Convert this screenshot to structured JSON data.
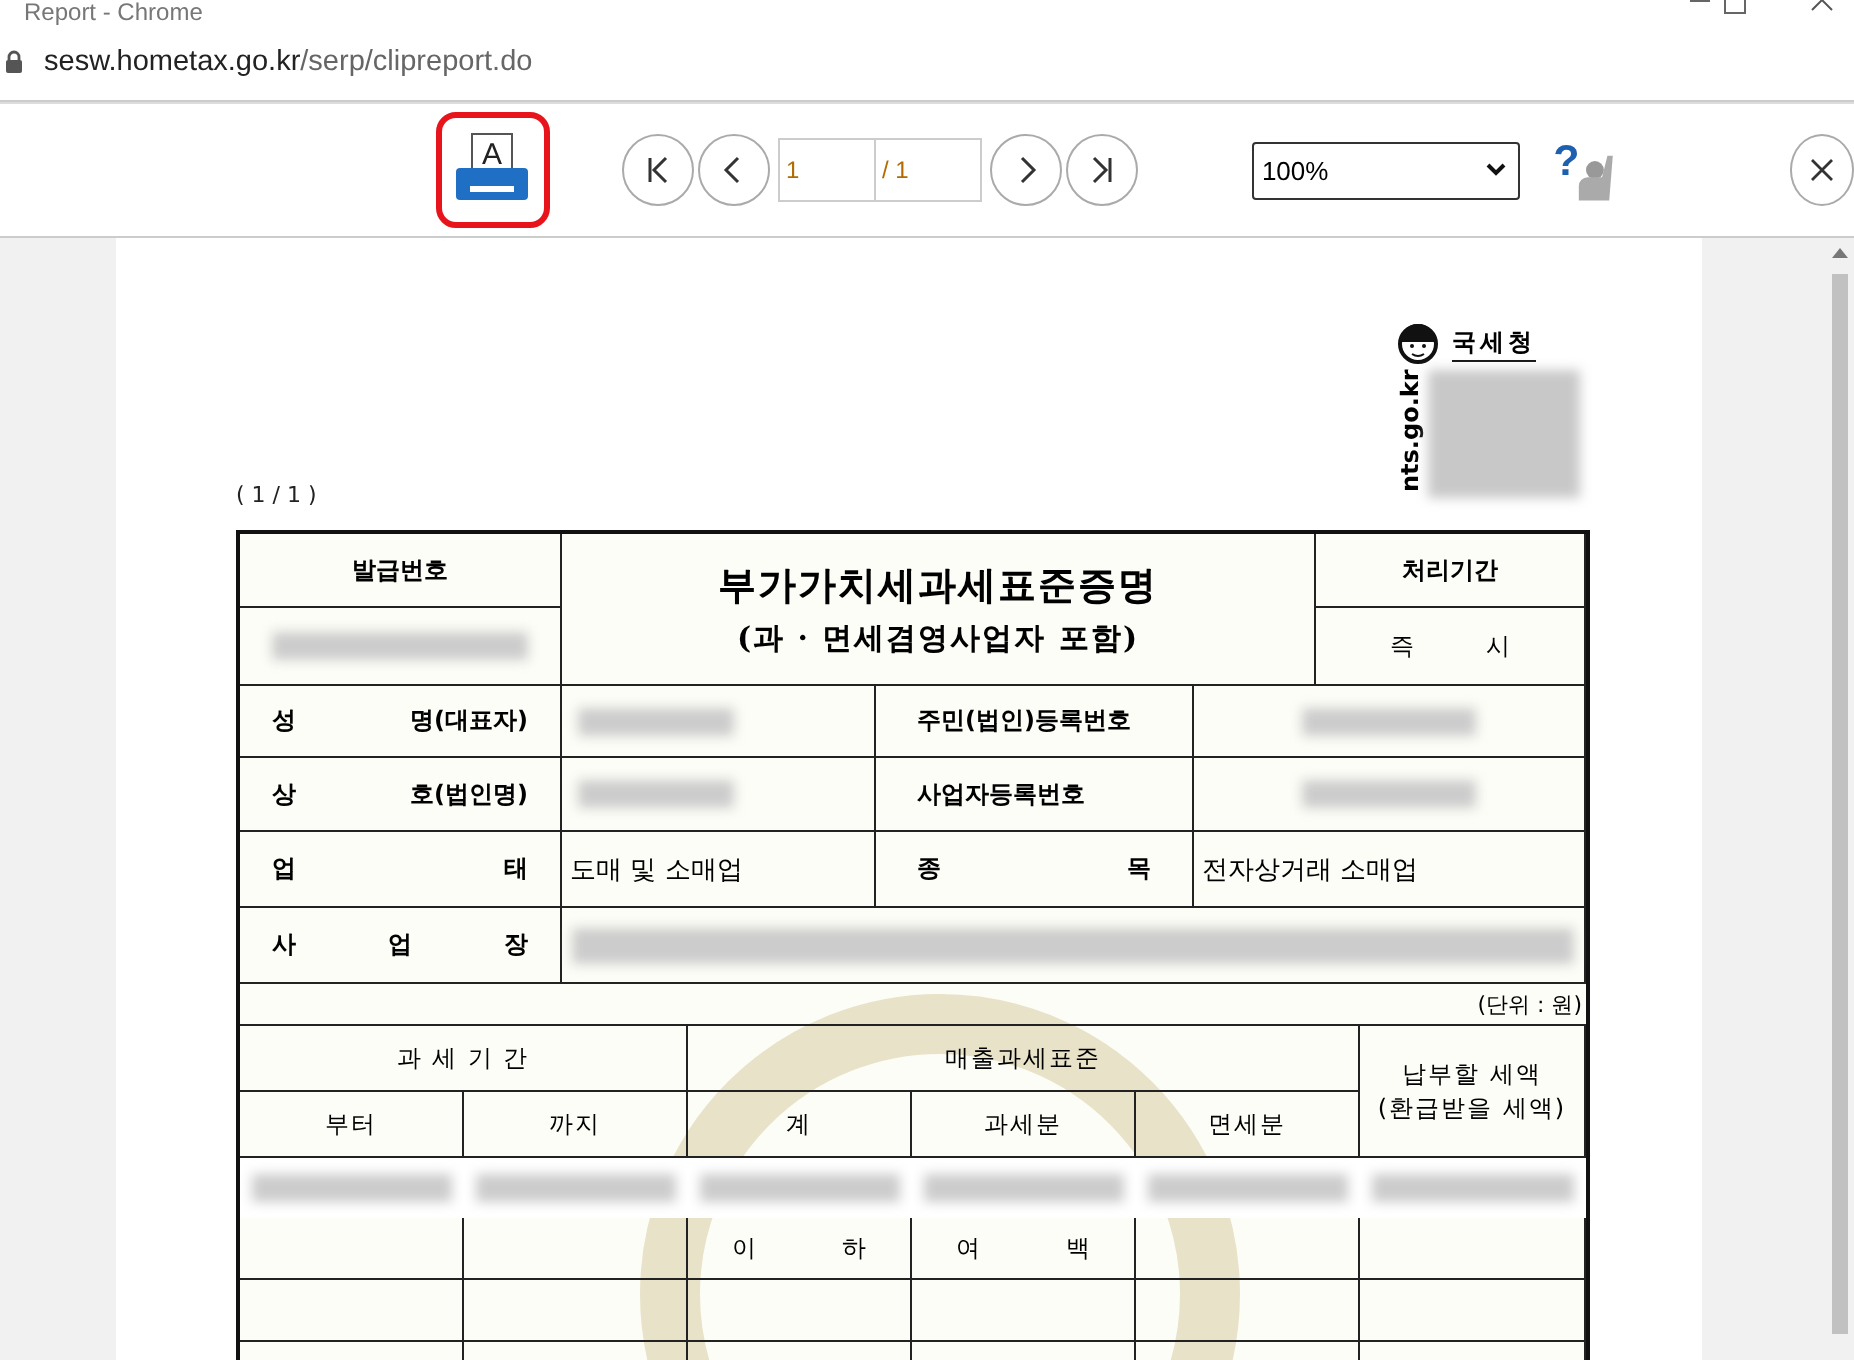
{
  "browser": {
    "title": "Report - Chrome",
    "url_domain": "sesw.hometax.go.kr",
    "url_path": "/serp/clipreport.do"
  },
  "toolbar": {
    "print_glyph": "A",
    "page": "1",
    "total": "/ 1",
    "zoom": "100%",
    "help_glyph": "?"
  },
  "document": {
    "page_counter": "( 1 / 1 )",
    "logo_text": "국세청",
    "logo_url": "nts.go.kr",
    "issue_no_label": "발급번호",
    "title": "부가가치세과세표준증명",
    "subtitle": "(과 · 면세겸영사업자 포함)",
    "period_label": "처리기간",
    "period_value": "즉 시",
    "info_rows": [
      {
        "label": "성 명(대표자)",
        "label2": "주민(법인)등록번호"
      },
      {
        "label": "상 호(법인명)",
        "label2": "사업자등록번호"
      },
      {
        "label": "업 태",
        "value": "도매 및 소매업",
        "label2": "종 목",
        "value2": "전자상거래 소매업"
      },
      {
        "label": "사 업 장"
      }
    ],
    "unit": "(단위 : 원)",
    "tax_table": {
      "period_header": "과 세 기 간",
      "base_header": "매출과세표준",
      "due_header": [
        "납부할 세액",
        "(환급받을 세액)"
      ],
      "sub_headers": [
        "부터",
        "까지",
        "계",
        "과세분",
        "면세분"
      ],
      "rows": [
        {
          "kind": "redacted"
        },
        {
          "kind": "text",
          "cells": [
            "",
            "",
            "이 하",
            "여 백",
            "",
            ""
          ]
        },
        {
          "kind": "text",
          "cells": [
            "",
            "",
            "",
            "",
            "",
            ""
          ]
        },
        {
          "kind": "text",
          "cells": [
            "",
            "",
            "",
            "",
            "",
            ""
          ]
        }
      ]
    }
  }
}
